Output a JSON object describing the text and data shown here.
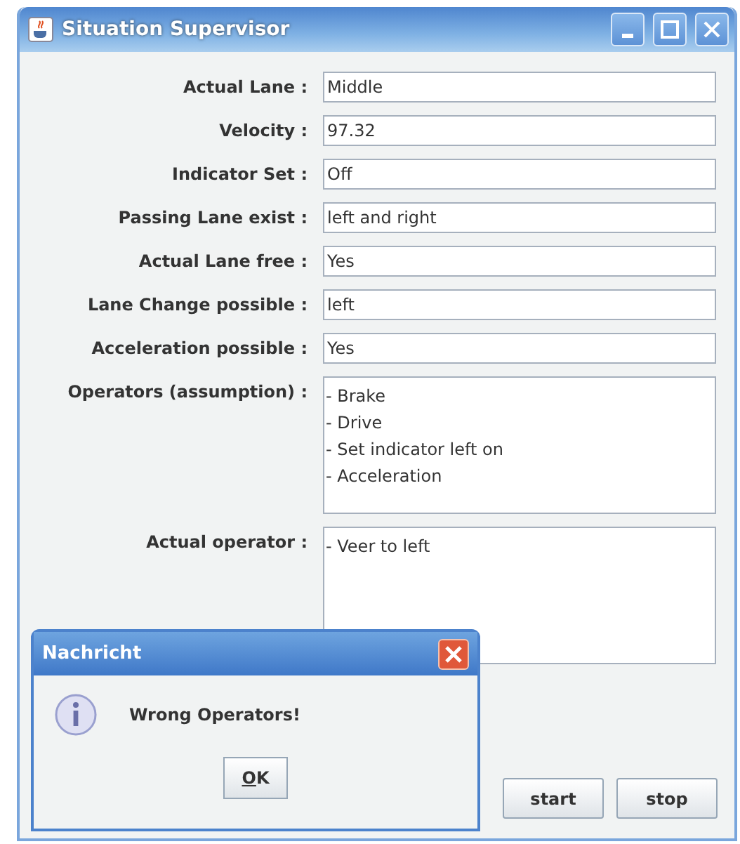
{
  "window": {
    "title": "Situation Supervisor"
  },
  "fields": [
    {
      "label": "Actual Lane :",
      "value": "Middle"
    },
    {
      "label": "Velocity :",
      "value": "97.32"
    },
    {
      "label": "Indicator Set :",
      "value": "Off"
    },
    {
      "label": "Passing Lane exist :",
      "value": "left and right"
    },
    {
      "label": "Actual Lane free :",
      "value": "Yes"
    },
    {
      "label": "Lane Change possible :",
      "value": "left"
    },
    {
      "label": "Acceleration possible :",
      "value": "Yes"
    }
  ],
  "areas": [
    {
      "label": "Operators (assumption) :",
      "lines": [
        "- Brake",
        "- Drive",
        "- Set indicator left on",
        "- Acceleration"
      ]
    },
    {
      "label": "Actual operator :",
      "lines": [
        "- Veer to left"
      ]
    }
  ],
  "buttons": [
    "start",
    "stop"
  ],
  "dialog": {
    "title": "Nachricht",
    "message": "Wrong Operators!",
    "button": "OK"
  }
}
